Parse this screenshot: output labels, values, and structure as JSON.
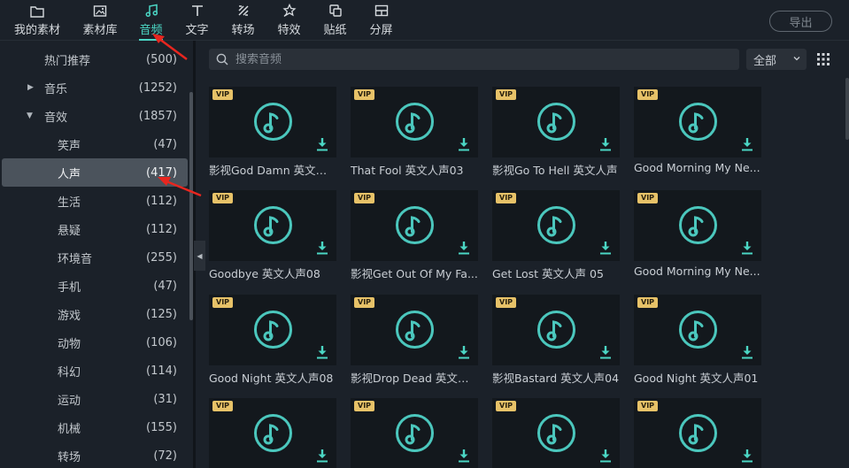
{
  "toolbar": {
    "tabs": [
      {
        "label": "我的素材",
        "icon": "folder-icon"
      },
      {
        "label": "素材库",
        "icon": "image-library-icon"
      },
      {
        "label": "音频",
        "icon": "music-note-icon"
      },
      {
        "label": "文字",
        "icon": "text-icon"
      },
      {
        "label": "转场",
        "icon": "transition-icon"
      },
      {
        "label": "特效",
        "icon": "effects-icon"
      },
      {
        "label": "贴纸",
        "icon": "sticker-icon"
      },
      {
        "label": "分屏",
        "icon": "split-screen-icon"
      }
    ],
    "active_tab": "音频",
    "export_label": "导出"
  },
  "sidebar": {
    "categories": [
      {
        "name": "热门推荐",
        "count": "(500)"
      },
      {
        "name": "音乐",
        "count": "(1252)"
      },
      {
        "name": "音效",
        "count": "(1857)"
      },
      {
        "name": "笑声",
        "count": "(47)"
      },
      {
        "name": "人声",
        "count": "(417)"
      },
      {
        "name": "生活",
        "count": "(112)"
      },
      {
        "name": "悬疑",
        "count": "(112)"
      },
      {
        "name": "环境音",
        "count": "(255)"
      },
      {
        "name": "手机",
        "count": "(47)"
      },
      {
        "name": "游戏",
        "count": "(125)"
      },
      {
        "name": "动物",
        "count": "(106)"
      },
      {
        "name": "科幻",
        "count": "(114)"
      },
      {
        "name": "运动",
        "count": "(31)"
      },
      {
        "name": "机械",
        "count": "(155)"
      },
      {
        "name": "转场",
        "count": "(72)"
      }
    ],
    "selected": "人声"
  },
  "search": {
    "placeholder": "搜索音频"
  },
  "filter": {
    "value": "全部"
  },
  "badge_label": "VIP",
  "cards": [
    {
      "title": "影视God Damn 英文人声"
    },
    {
      "title": "That Fool 英文人声03"
    },
    {
      "title": "影视Go To Hell 英文人声"
    },
    {
      "title": "Good Morning My Ne..."
    },
    {
      "title": "Goodbye 英文人声08"
    },
    {
      "title": "影视Get Out Of My Fa..."
    },
    {
      "title": "Get Lost 英文人声 05"
    },
    {
      "title": "Good Morning My Ne..."
    },
    {
      "title": "Good Night 英文人声08"
    },
    {
      "title": "影视Drop Dead 英文人声"
    },
    {
      "title": "影视Bastard 英文人声04"
    },
    {
      "title": "Good Night 英文人声01"
    },
    {
      "title": ""
    },
    {
      "title": ""
    },
    {
      "title": ""
    },
    {
      "title": ""
    }
  ],
  "colors": {
    "accent": "#4bd6c4",
    "vip": "#e7c268",
    "annotation": "#e8261f"
  }
}
